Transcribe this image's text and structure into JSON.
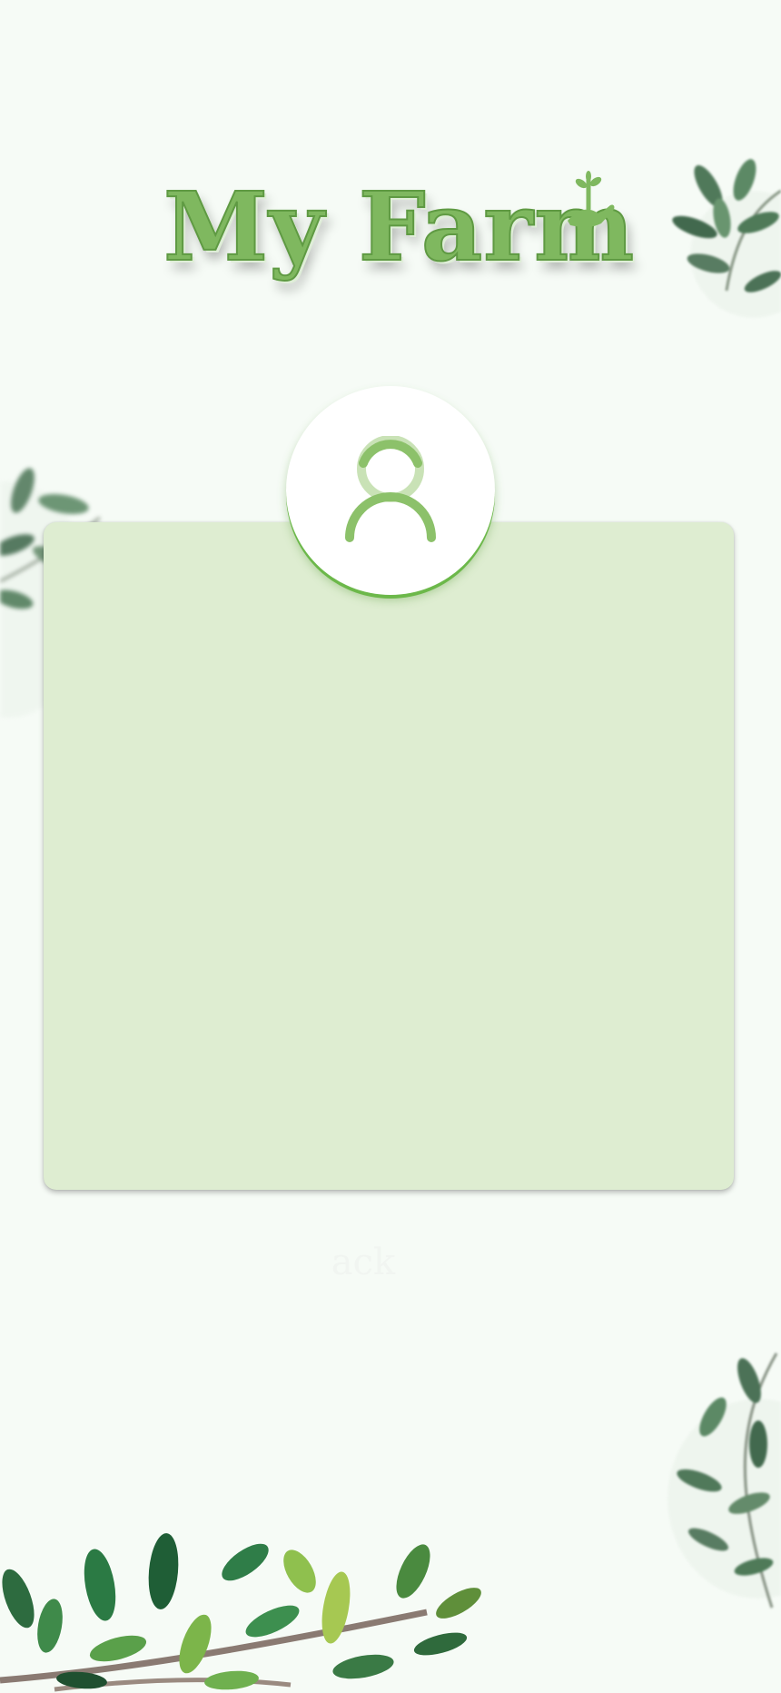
{
  "app": {
    "title": "My Farm"
  },
  "icons": {
    "logo_sprout": "sprout-in-hand-icon",
    "avatar": "user-icon"
  },
  "colors": {
    "background": "#f6fbf6",
    "card": "#deedd1",
    "accent": "#7fb85f",
    "avatar_ring": "#6cb84a"
  },
  "footer": {
    "hint": "ack"
  }
}
